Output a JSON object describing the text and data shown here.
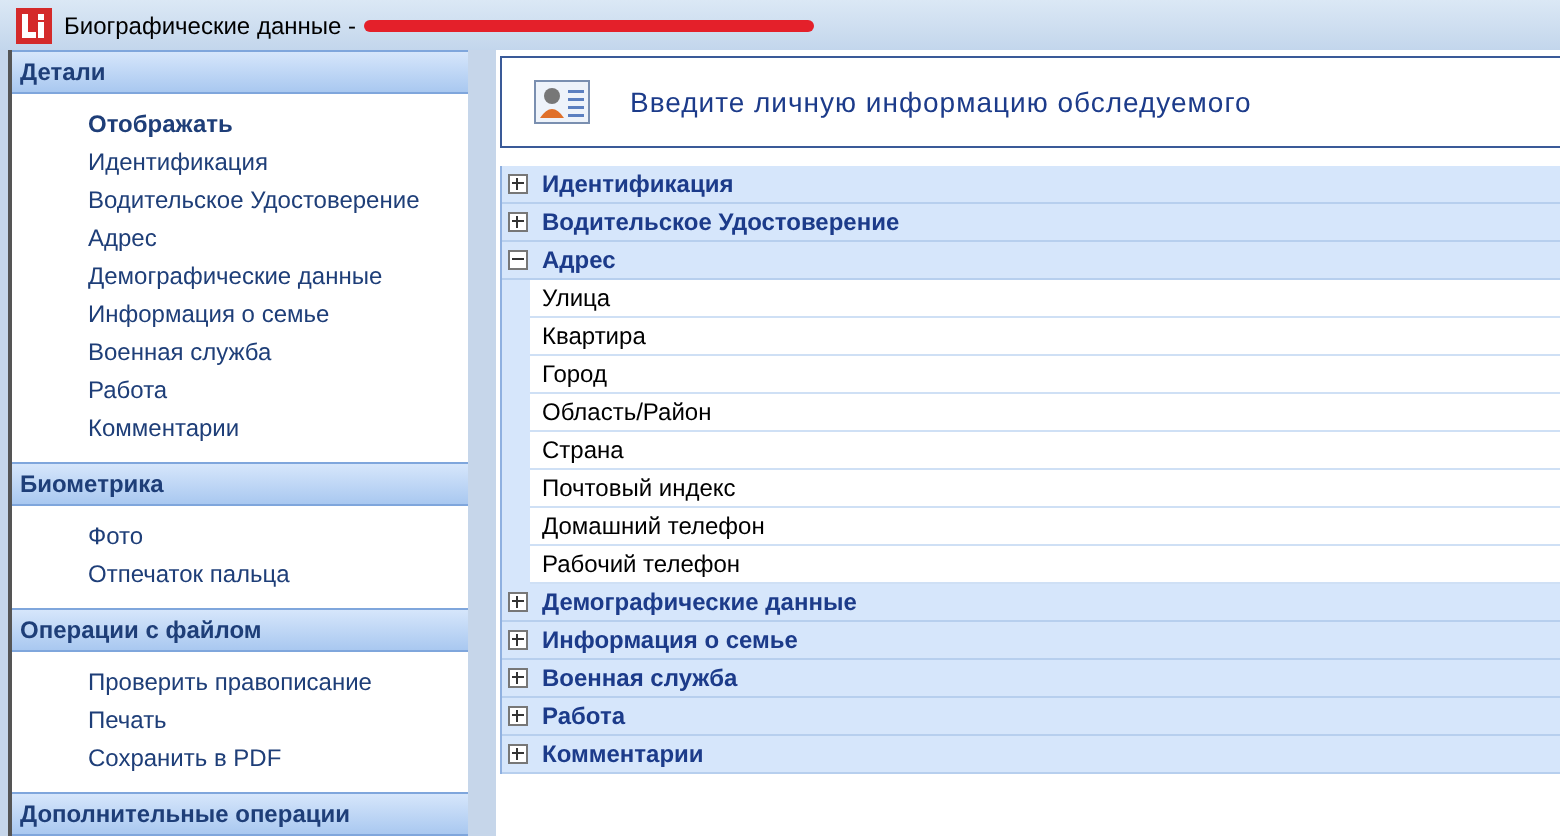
{
  "window": {
    "title": "Биографические данные -"
  },
  "sidebar": {
    "groups": [
      {
        "title": "Детали",
        "items": [
          {
            "label": "Отображать",
            "selected": true
          },
          {
            "label": "Идентификация",
            "selected": false
          },
          {
            "label": "Водительское Удостоверение",
            "selected": false
          },
          {
            "label": "Адрес",
            "selected": false
          },
          {
            "label": "Демографические данные",
            "selected": false
          },
          {
            "label": "Информация о семье",
            "selected": false
          },
          {
            "label": "Военная служба",
            "selected": false
          },
          {
            "label": "Работа",
            "selected": false
          },
          {
            "label": "Комментарии",
            "selected": false
          }
        ]
      },
      {
        "title": "Биометрика",
        "items": [
          {
            "label": "Фото",
            "selected": false
          },
          {
            "label": "Отпечаток пальца",
            "selected": false
          }
        ]
      },
      {
        "title": "Операции с файлом",
        "items": [
          {
            "label": "Проверить правописание",
            "selected": false
          },
          {
            "label": "Печать",
            "selected": false
          },
          {
            "label": "Сохранить в PDF",
            "selected": false
          }
        ]
      },
      {
        "title": "Дополнительные операции"
      }
    ]
  },
  "header": {
    "title": "Введите личную информацию обследуемого"
  },
  "property_grid": {
    "categories": [
      {
        "label": "Идентификация",
        "expanded": false
      },
      {
        "label": "Водительское Удостоверение",
        "expanded": false
      },
      {
        "label": "Адрес",
        "expanded": true,
        "fields": [
          "Улица",
          "Квартира",
          "Город",
          "Область/Район",
          "Страна",
          "Почтовый индекс",
          "Домашний телефон",
          "Рабочий телефон"
        ]
      },
      {
        "label": "Демографические данные",
        "expanded": false
      },
      {
        "label": "Информация о семье",
        "expanded": false
      },
      {
        "label": "Военная служба",
        "expanded": false
      },
      {
        "label": "Работа",
        "expanded": false
      },
      {
        "label": "Комментарии",
        "expanded": false
      }
    ]
  }
}
